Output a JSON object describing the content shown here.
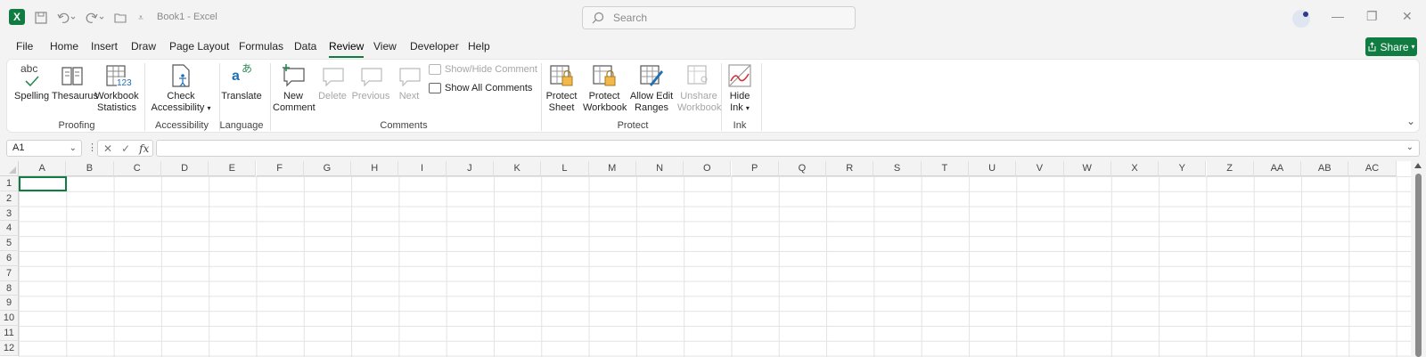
{
  "titlebar": {
    "doc_title": "Book1  -  Excel",
    "search_placeholder": "Search"
  },
  "menu": [
    "File",
    "Home",
    "Insert",
    "Draw",
    "Page Layout",
    "Formulas",
    "Data",
    "Review",
    "View",
    "Developer",
    "Help"
  ],
  "active_tab": "Review",
  "share_label": "Share",
  "ribbon": {
    "proofing": {
      "label": "Proofing",
      "spelling": "Spelling",
      "thesaurus": "Thesaurus",
      "workbook_stats_1": "Workbook",
      "workbook_stats_2": "Statistics",
      "abc": "abc",
      "n123": "123"
    },
    "accessibility": {
      "label": "Accessibility",
      "check_1": "Check",
      "check_2": "Accessibility"
    },
    "language": {
      "label": "Language",
      "translate": "Translate"
    },
    "comments": {
      "label": "Comments",
      "new_1": "New",
      "new_2": "Comment",
      "delete": "Delete",
      "previous": "Previous",
      "next": "Next",
      "show_hide": "Show/Hide Comment",
      "show_all": "Show All Comments"
    },
    "protect": {
      "label": "Protect",
      "sheet_1": "Protect",
      "sheet_2": "Sheet",
      "workbook_1": "Protect",
      "workbook_2": "Workbook",
      "allow_1": "Allow Edit",
      "allow_2": "Ranges",
      "unshare_1": "Unshare",
      "unshare_2": "Workbook"
    },
    "ink": {
      "label": "Ink",
      "hide_1": "Hide",
      "hide_2": "Ink"
    }
  },
  "formula_bar": {
    "name_box": "A1",
    "fx": "fx",
    "value": ""
  },
  "columns": [
    "A",
    "B",
    "C",
    "D",
    "E",
    "F",
    "G",
    "H",
    "I",
    "J",
    "K",
    "L",
    "M",
    "N",
    "O",
    "P",
    "Q",
    "R",
    "S",
    "T",
    "U",
    "V",
    "W",
    "X",
    "Y",
    "Z",
    "AA",
    "AB",
    "AC"
  ],
  "rows": [
    "1",
    "2",
    "3",
    "4",
    "5",
    "6",
    "7",
    "8",
    "9",
    "10",
    "11",
    "12"
  ],
  "colors": {
    "accent": "#107c41",
    "ribbon_bg": "#ffffff",
    "chrome_bg": "#f3f3f3"
  }
}
